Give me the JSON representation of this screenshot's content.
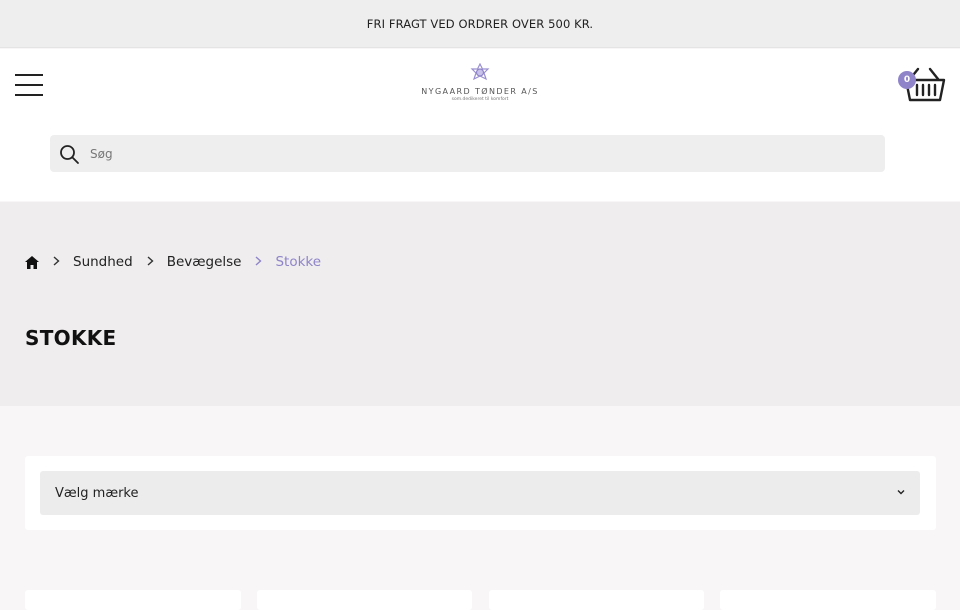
{
  "announcement": {
    "text": "FRI FRAGT VED ORDRER OVER 500 KR."
  },
  "header": {
    "logo": {
      "name": "NYGAARD TØNDER A/S",
      "tagline": "som.dedikeret til komfort"
    },
    "cart": {
      "count": "0"
    },
    "search": {
      "placeholder": "Søg"
    }
  },
  "breadcrumb": {
    "items": [
      {
        "label": "Sundhed"
      },
      {
        "label": "Bevægelse"
      }
    ],
    "current": "Stokke"
  },
  "page": {
    "title": "STOKKE"
  },
  "filter": {
    "brand_select_label": "Vælg mærke"
  },
  "colors": {
    "accent": "#8f84c9",
    "band": "#efedee",
    "search_bg": "#eeeeee"
  },
  "icons": [
    "menu-icon",
    "logo-icon",
    "basket-icon",
    "search-icon",
    "home-icon",
    "chevron-right-icon",
    "chevron-down-icon"
  ]
}
